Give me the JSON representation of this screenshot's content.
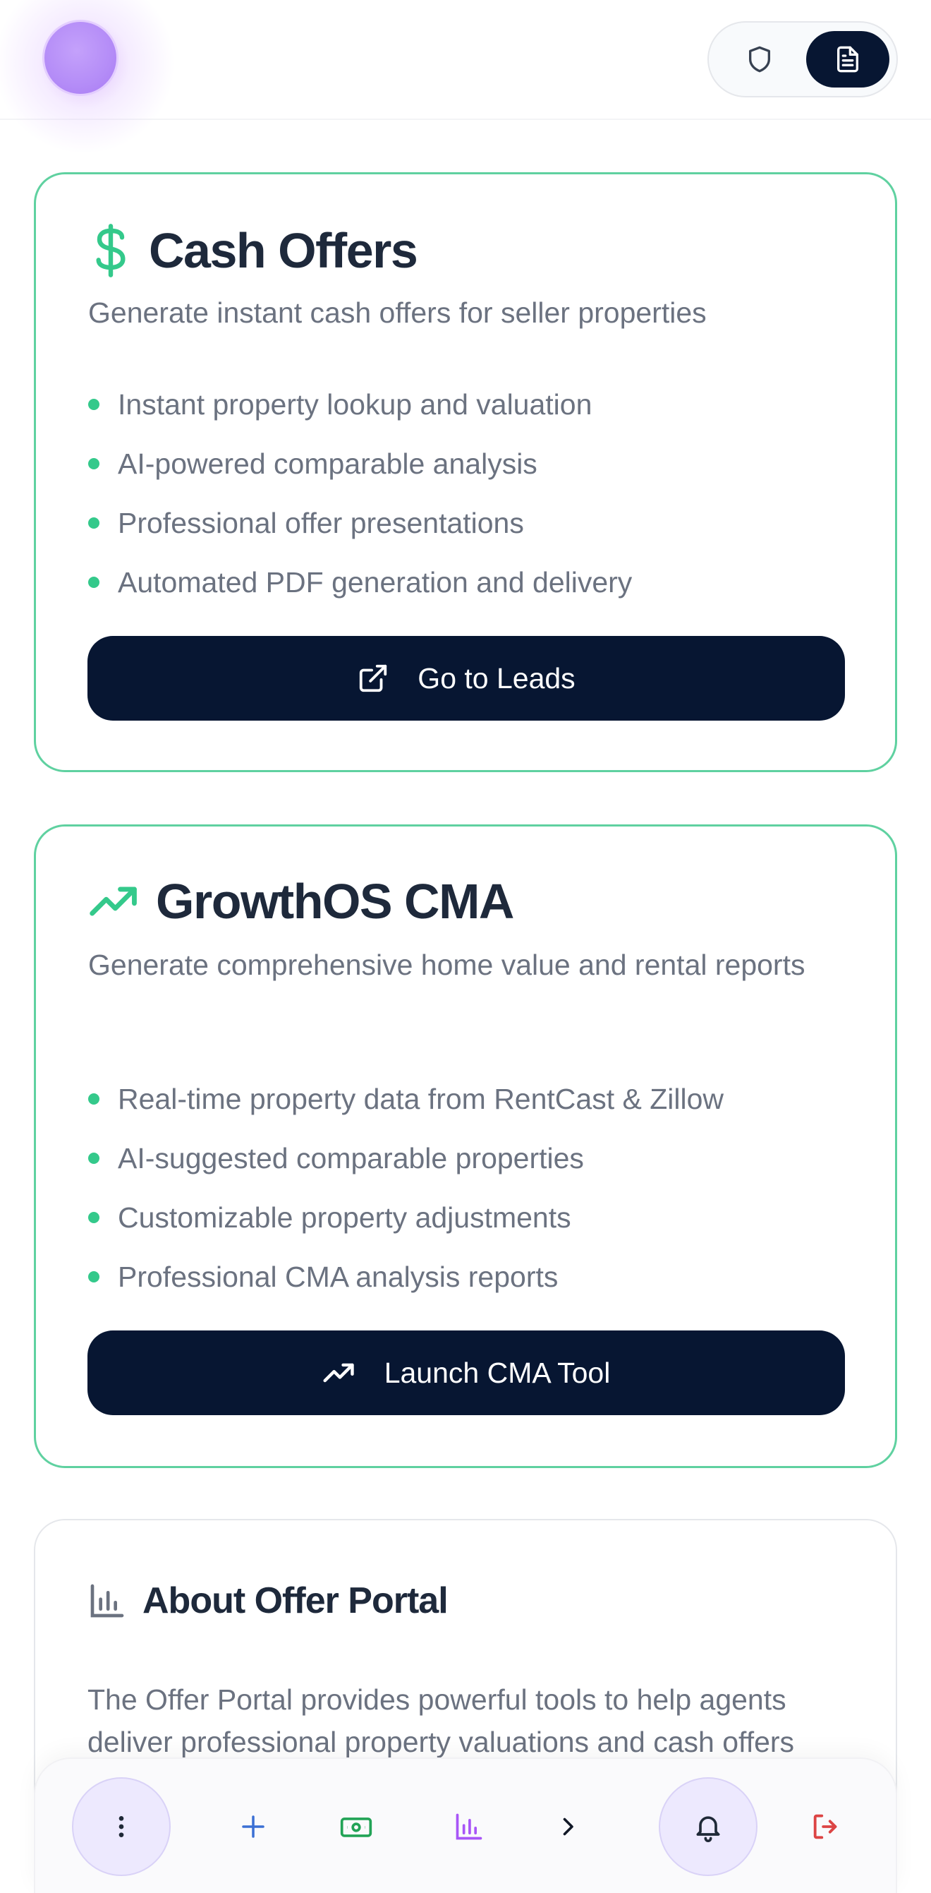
{
  "header": {
    "mode_icons": [
      "shield-icon",
      "document-icon"
    ],
    "active_mode": "document"
  },
  "cash_offers": {
    "icon": "dollar-icon",
    "title": "Cash Offers",
    "subtitle": "Generate instant cash offers for seller properties",
    "features": [
      "Instant property lookup and valuation",
      "AI-powered comparable analysis",
      "Professional offer presentations",
      "Automated PDF generation and delivery"
    ],
    "cta_icon": "external-link-icon",
    "cta_label": "Go to Leads"
  },
  "cma": {
    "icon": "trending-up-icon",
    "title": "GrowthOS CMA",
    "subtitle": "Generate comprehensive home value and rental reports",
    "features": [
      "Real-time property data from RentCast & Zillow",
      "AI-suggested comparable properties",
      "Customizable property adjustments",
      "Professional CMA analysis reports"
    ],
    "cta_icon": "trending-up-icon",
    "cta_label": "Launch CMA Tool"
  },
  "about": {
    "icon": "bar-chart-icon",
    "title": "About Offer Portal",
    "text": "The Offer Portal provides powerful tools to help agents deliver professional property valuations and cash offers"
  },
  "bottom_nav": {
    "items": [
      "more-icon",
      "plus-icon",
      "cash-icon",
      "bar-chart-icon",
      "chevron-right-icon",
      "bell-icon",
      "logout-icon"
    ]
  },
  "colors": {
    "accent_green": "#34c98b",
    "card_border": "#5fd1a0",
    "button_dark": "#071632",
    "text_dark": "#1e293b",
    "text_muted": "#6b7280",
    "avatar_purple": "#b48cf7"
  }
}
